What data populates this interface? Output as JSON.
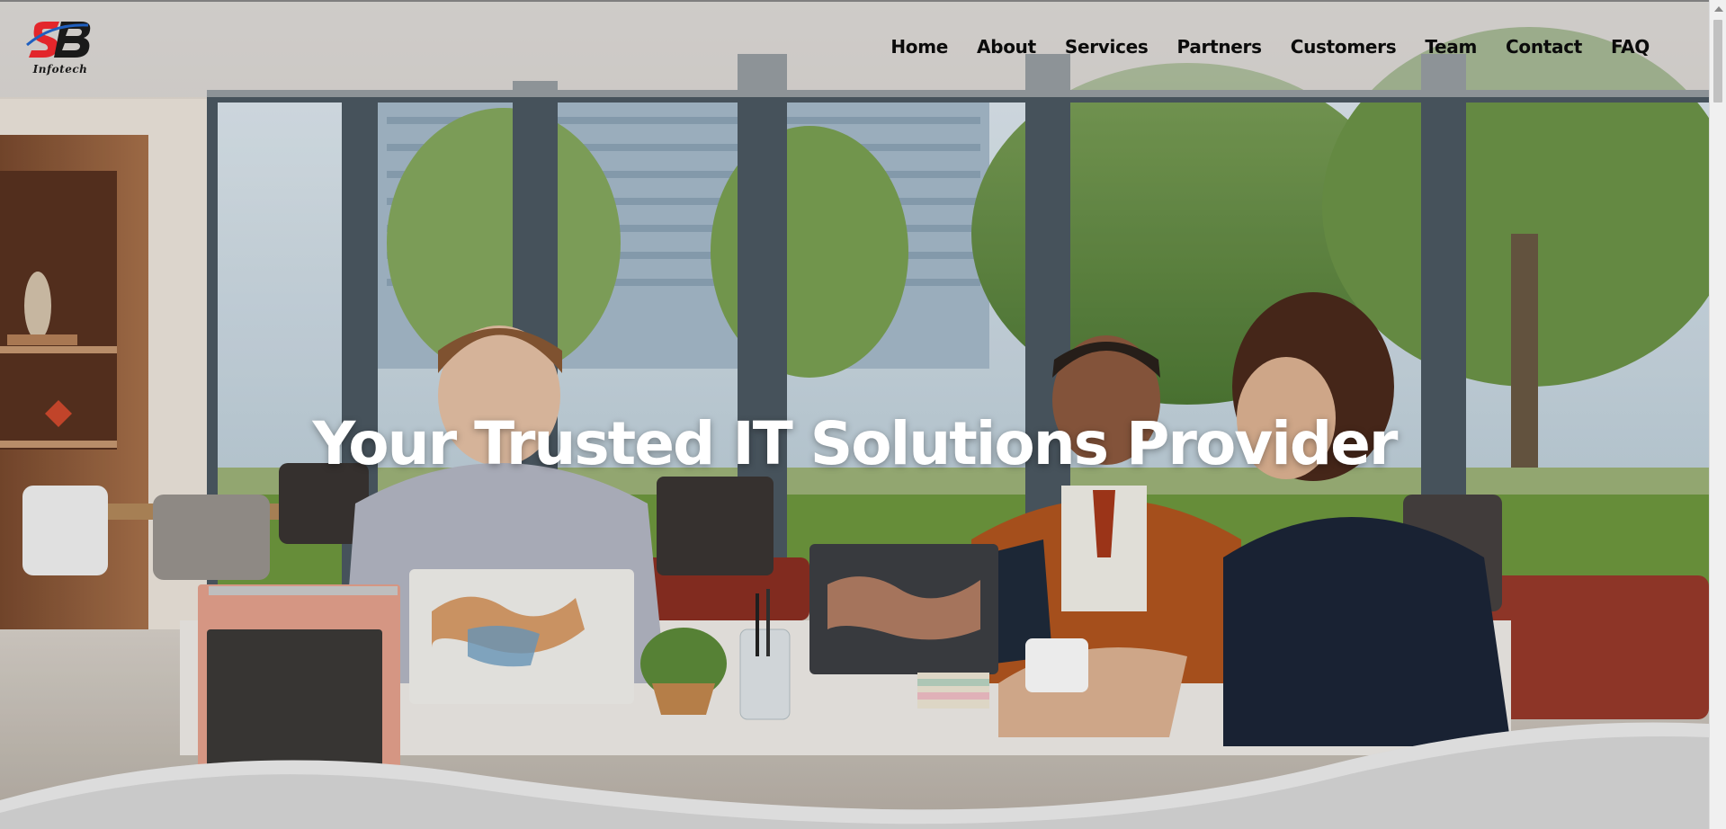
{
  "brand": {
    "logo_text": "Infotech",
    "colors": {
      "logo_red": "#e3262b",
      "logo_blue": "#1f5fbf",
      "logo_dark": "#1a1a1a"
    }
  },
  "nav": {
    "items": [
      {
        "label": "Home"
      },
      {
        "label": "About"
      },
      {
        "label": "Services"
      },
      {
        "label": "Partners"
      },
      {
        "label": "Customers"
      },
      {
        "label": "Team"
      },
      {
        "label": "Contact"
      },
      {
        "label": "FAQ"
      }
    ]
  },
  "hero": {
    "headline": "Your Trusted IT Solutions Provider",
    "image_icon": "office-team-meeting-photo"
  },
  "colors": {
    "headline": "#ffffff",
    "nav_text": "#0b0b0b",
    "header_bg": "rgba(200,200,200,0.55)",
    "wave": "#c9c9c9"
  }
}
